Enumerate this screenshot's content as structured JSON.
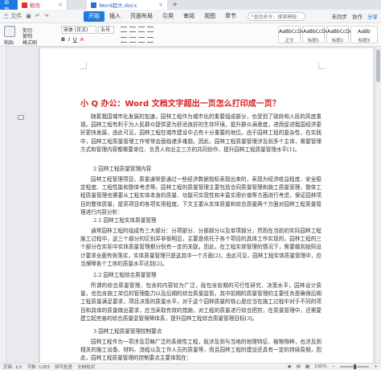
{
  "tabs": {
    "home": "首页",
    "wps": "稻壳",
    "doc": "Word超大.docx",
    "new_tab": "+"
  },
  "menu": {
    "file": "三 文件",
    "items": [
      "开始",
      "插入",
      "页面布局",
      "引用",
      "审阅",
      "视图",
      "章节"
    ],
    "active": "开始",
    "search": "查找命令、搜索模板",
    "unsynced": "未同步",
    "share": "分享",
    "collab": "协作"
  },
  "ribbon": {
    "paste": "粘贴",
    "cut": "剪切",
    "copy": "复制",
    "format_painter": "格式刷",
    "font": "宋体 (正文)",
    "size": "五号",
    "bold": "B",
    "italic": "I",
    "underline": "U",
    "font_color": "A",
    "styles": [
      {
        "sample": "AaBbCcDd",
        "name": "正文"
      },
      {
        "sample": "AaBbCcDd",
        "name": "标题1"
      },
      {
        "sample": "AaBbCcDd",
        "name": "标题2"
      },
      {
        "sample": "AaBb",
        "name": "标题3"
      }
    ]
  },
  "document": {
    "title": "小 Q 办公：Word 文档文字超出一页怎么打印成一页？",
    "p1": "随着我国城市化发展的加速，园林工程作为城市化的重要组成部分，也受到了政府和人民的高度重视。园林工程有利于为人民群众提供更为舒适良好的生存环境，提升群众满意度，进而促进我国经济更好更快发展，由此可见，园林工程在城市建设中占有十分重要的地位。由于园林工程的复杂性，在实践中，园林工程质量管理工作常常会面临诸多难题。因此，园林工程质量管理涉及到多个主体，需要管理方式和管理内容都需要单位、负责人和业主三方的共同协作，提升园林工程质量管理水平[1]。",
    "h2": "2 园林工程质量管理内容",
    "p2": "园林工程管理项目，质量通常是通过一些经济数据指标表现出来的，表现为经济收益程度、安全稳定程度、工程性能和整体考虑等。园林工程的质量管理主要包括合同质量管理和施工质量管理，整体工程质量管理也需要从工程实体本身的质量、功能可实现性和丰富实用价值等方面进行考虑，保证园林项目的整体质量，提高项目的各项实用程度。下文主要从实体质量和综合质量两个方面对园林工程质量管理进行内容分析：",
    "h21": "2.1 园林工程实体质量管理",
    "p3": "通常园林工程的组成有三大部分：分项部分、分部部分以及单项部分，然而在当前的实际园林工程施工过程中，这三个部分的区别并非很明显，主要是依托于各个项目的具体工作实现的，园林工程的三个部分在实际中实体质量管理都分别有一定的关联。因此，在工程实体管理的情况下，需要做到按照设计要求全面有效落实，实体质量管理只是这其中一个方面[2]，由此可见，园林工程实体质量管理中，应当保障各个工序的质量水平达到[2]。",
    "h22": "2.2 园林工程综合质量管理",
    "p4": "所谓的综合质量管理，包含的内容较为广泛，既包含前期的可行性研究、决策水平，园林设计质量，也包含施工单位的管理能力以及后期的综合质量监管。其中前期的质量管理的主要任务是确保后期工程质量满足要求，项目决策的质量水平，对于这个园林质量的核心是应当在施工过程中对于不同的项目和具体的质量做出要求，应当采取有效的措施，对工程的质量进行综合把控，在质量管理中，还需要建立起完善的综合质量监管保障体系，提升园林工程综合质量管理目标[3]。",
    "h3": "3 园林工程质量管理控制要点",
    "p5": "园林工程作为一项涉及范畴广泛的系统性工程，既涉及到与当地的地理特征、植物物种，也涉及到相关的施工设备、材料、流程以及工作人员的质量等，而且园林工程的建设还具有一定的持续周期，因此，园林工程质量管理的控制要点主要体现在："
  },
  "status": {
    "page": "页面: 1/2",
    "words": "字数: 1283",
    "spell": "拼写检查",
    "doc_check": "文档校对",
    "zoom": "100%",
    "zoom_fraction": 0.5
  },
  "colors": {
    "accent": "#1f7ae0",
    "title_red": "#d81e1e",
    "wps_red": "#e0332d"
  }
}
